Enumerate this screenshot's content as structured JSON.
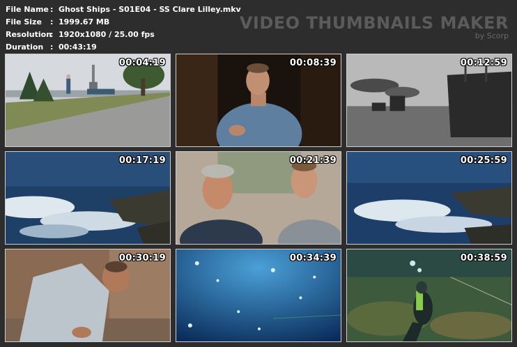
{
  "file_info": [
    {
      "label": "File Name",
      "value": "Ghost Ships - S01E04 - SS Clare Lilley.mkv"
    },
    {
      "label": "File Size",
      "value": "1999.67 MB"
    },
    {
      "label": "Resolution",
      "value": "1920x1080 / 25.00 fps"
    },
    {
      "label": "Duration",
      "value": "00:43:19"
    }
  ],
  "separator": ":",
  "brand": {
    "title": "VIDEO THUMBNAILS MAKER",
    "byline": "by Scorp"
  },
  "thumbnails": [
    {
      "timestamp": "00:04:19",
      "scene": "coastal path with monument"
    },
    {
      "timestamp": "00:08:39",
      "scene": "man in denim shirt interview"
    },
    {
      "timestamp": "00:12:59",
      "scene": "archival steamships at sea"
    },
    {
      "timestamp": "00:17:19",
      "scene": "waves crashing on rocks"
    },
    {
      "timestamp": "00:21:39",
      "scene": "two men talking"
    },
    {
      "timestamp": "00:25:59",
      "scene": "waves crashing on rocks"
    },
    {
      "timestamp": "00:30:19",
      "scene": "man examining rocky beach"
    },
    {
      "timestamp": "00:34:39",
      "scene": "underwater bubbles"
    },
    {
      "timestamp": "00:38:59",
      "scene": "scuba diver on seabed"
    }
  ]
}
